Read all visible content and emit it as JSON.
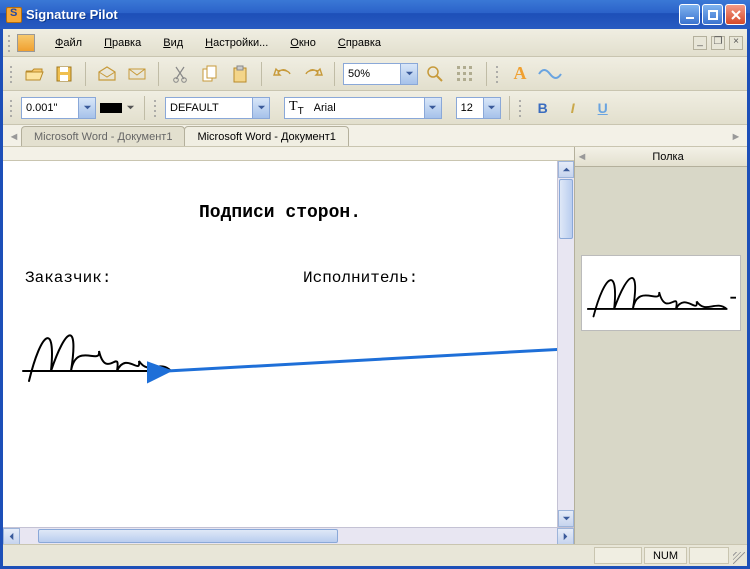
{
  "window": {
    "title": "Signature Pilot"
  },
  "menu": {
    "file": {
      "label": "Файл",
      "accel": "Ф"
    },
    "edit": {
      "label": "Правка",
      "accel": "П"
    },
    "view": {
      "label": "Вид",
      "accel": "В"
    },
    "settings": {
      "label": "Настройки...",
      "accel": "Н"
    },
    "window": {
      "label": "Окно",
      "accel": "О"
    },
    "help": {
      "label": "Справка",
      "accel": "С"
    }
  },
  "toolbar1": {
    "zoom": "50%"
  },
  "toolbar2": {
    "line_width": "0.001\"",
    "font_style": "DEFAULT",
    "font_name": "Arial",
    "font_size": "12",
    "bold": "B",
    "italic": "I",
    "underline": "U"
  },
  "tabs": [
    {
      "label": "Microsoft Word - Документ1",
      "active": false
    },
    {
      "label": "Microsoft Word - Документ1",
      "active": true
    }
  ],
  "document": {
    "heading": "Подписи сторон.",
    "party_customer": "Заказчик:",
    "party_executor": "Исполнитель:"
  },
  "shelf": {
    "title": "Полка"
  },
  "status": {
    "num": "NUM"
  },
  "icons": {
    "A": "A"
  }
}
